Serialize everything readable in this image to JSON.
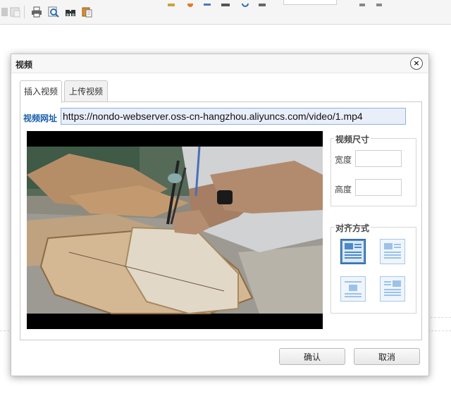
{
  "dialog": {
    "title": "视频",
    "close_label": "×",
    "tabs": [
      {
        "label": "插入视频",
        "active": true
      },
      {
        "label": "上传视频",
        "active": false
      }
    ],
    "url_label": "视频网址",
    "url_value": "https://nondo-webserver.oss-cn-hangzhou.aliyuncs.com/video/1.mp4",
    "size_section": {
      "legend": "视频尺寸",
      "width_label": "宽度",
      "height_label": "高度",
      "width_value": "",
      "height_value": ""
    },
    "align_section": {
      "legend": "对齐方式",
      "options": [
        "align-none",
        "align-left",
        "align-right",
        "align-center"
      ],
      "selected": "align-none"
    },
    "buttons": {
      "ok_label": "确认",
      "cancel_label": "取消"
    }
  },
  "colors": {
    "label_blue": "#1a5fa8",
    "input_bg": "#e9eff9",
    "input_border": "#8eb3dd"
  }
}
